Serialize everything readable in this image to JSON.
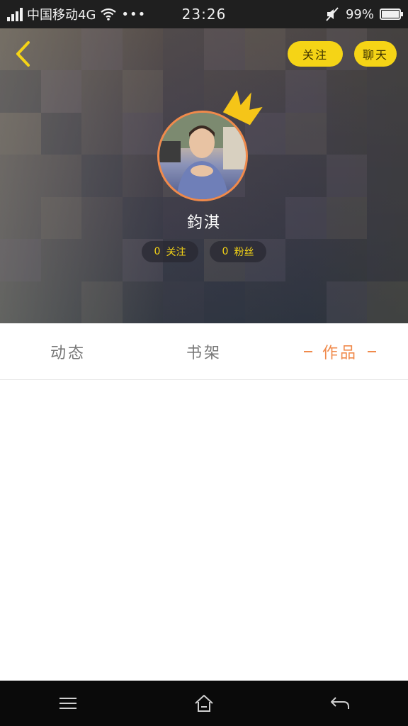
{
  "status_bar": {
    "carrier": "中国移动4G",
    "time": "23:26",
    "battery": "99%",
    "battery_level": 0.99,
    "icons": [
      "signal-icon",
      "wifi-icon",
      "more-dots-icon",
      "mute-icon",
      "battery-icon"
    ]
  },
  "header": {
    "back_icon": "chevron-left-icon",
    "follow_button": "关注",
    "chat_button": "聊天"
  },
  "profile": {
    "avatar_icon": "avatar-image",
    "crown_icon": "crown-icon",
    "name": "鈞淇",
    "following_count": "0",
    "following_label": "关注",
    "fans_count": "0",
    "fans_label": "粉丝"
  },
  "tabs": [
    {
      "label": "动态",
      "active": false
    },
    {
      "label": "书架",
      "active": false
    },
    {
      "label": "作品",
      "active": true
    }
  ],
  "navbar": {
    "icons": [
      "menu-icon",
      "home-icon",
      "back-arrow-icon"
    ]
  },
  "colors": {
    "accent": "#f08a4b",
    "yellow": "#f5d416"
  }
}
